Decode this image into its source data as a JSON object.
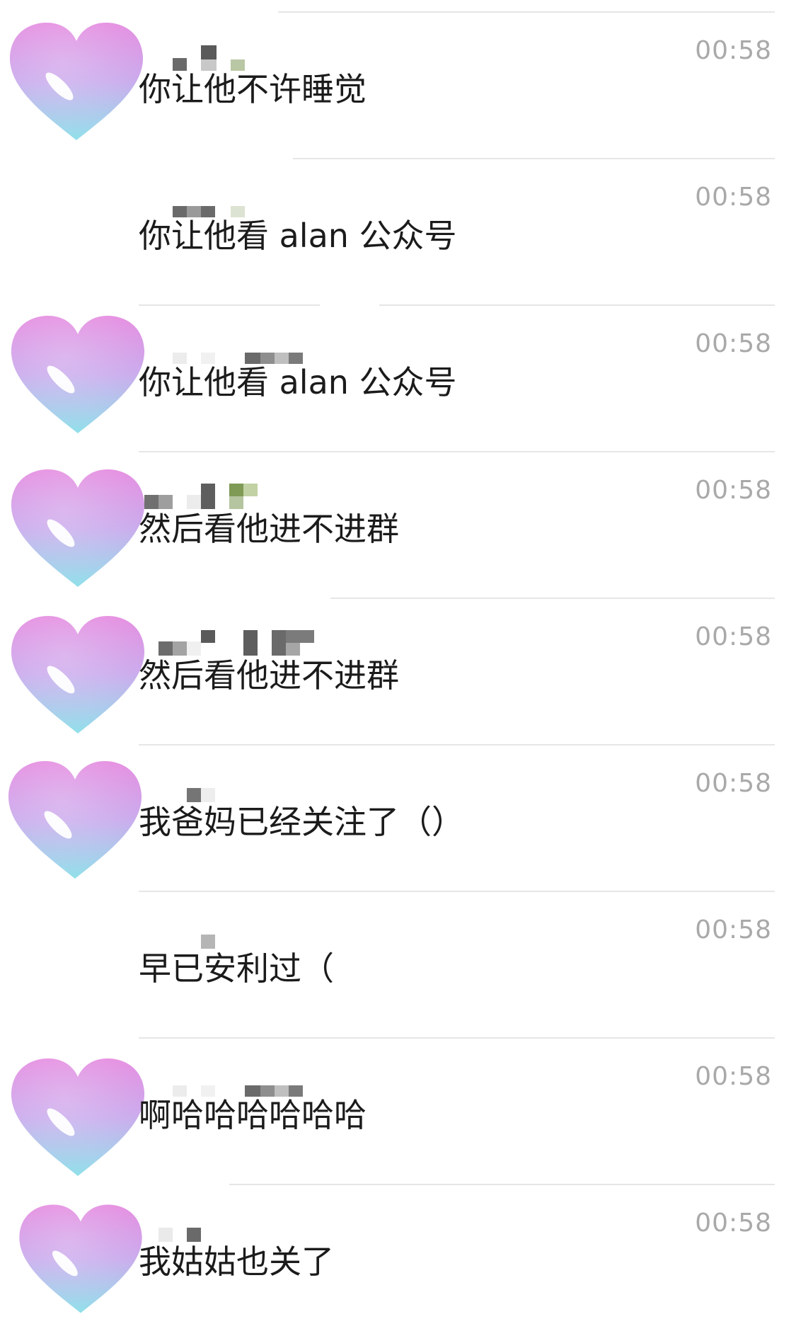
{
  "chat": {
    "messages": [
      {
        "avatar": "heart-icon",
        "name": "",
        "text": "你让他不许睡觉",
        "time": "00:58"
      },
      {
        "avatar": "",
        "name": "",
        "text": "你让他看 alan 公众号",
        "time": "00:58"
      },
      {
        "avatar": "heart-icon",
        "name": "",
        "text": "你让他看 alan 公众号",
        "time": "00:58"
      },
      {
        "avatar": "heart-icon",
        "name": "",
        "text": "然后看他进不进群",
        "time": "00:58"
      },
      {
        "avatar": "heart-icon",
        "name": "",
        "text": "然后看他进不进群",
        "time": "00:58"
      },
      {
        "avatar": "heart-icon",
        "name": "",
        "text": "我爸妈已经关注了（）",
        "time": "00:58"
      },
      {
        "avatar": "",
        "name": "",
        "text": "早已安利过（",
        "time": "00:58"
      },
      {
        "avatar": "heart-icon",
        "name": "",
        "text": "啊哈哈哈哈哈哈",
        "time": "00:58"
      },
      {
        "avatar": "heart-icon",
        "name": "",
        "text": "我姑姑也关了",
        "time": "00:58"
      }
    ]
  },
  "colors": {
    "background": "#ffffff",
    "message_text": "#1b1b1b",
    "timestamp": "#a9a9a9",
    "divider": "#e6e6e6",
    "heart_top": "#e58be0",
    "heart_bottom": "#8fe0ea"
  }
}
